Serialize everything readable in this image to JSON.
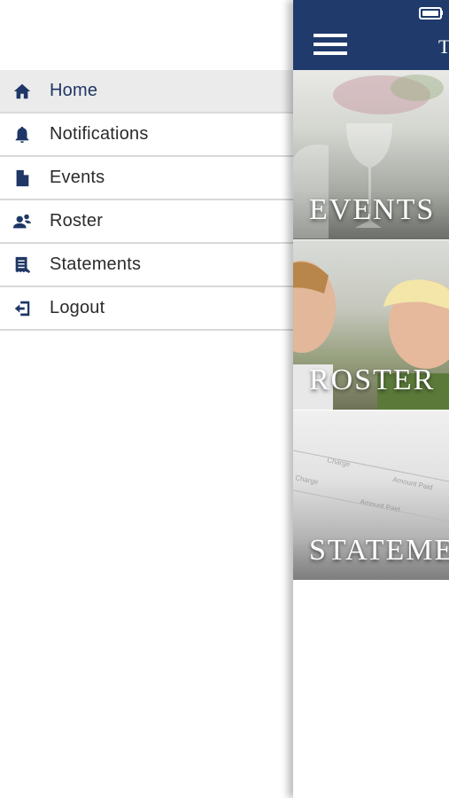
{
  "menu": {
    "items": [
      {
        "label": "Home",
        "icon": "home-icon",
        "active": true
      },
      {
        "label": "Notifications",
        "icon": "bell-icon"
      },
      {
        "label": "Events",
        "icon": "document-icon"
      },
      {
        "label": "Roster",
        "icon": "people-icon"
      },
      {
        "label": "Statements",
        "icon": "statement-icon"
      },
      {
        "label": "Logout",
        "icon": "logout-icon"
      }
    ]
  },
  "main": {
    "title_fragment": "T",
    "tiles": [
      {
        "label": "EVENTS"
      },
      {
        "label": "ROSTER"
      },
      {
        "label": "STATEMENTS"
      }
    ]
  },
  "colors": {
    "accent": "#1f3a6b",
    "icon": "#1f3766",
    "active_row": "#ebebeb",
    "divider": "#d9d9d9"
  }
}
